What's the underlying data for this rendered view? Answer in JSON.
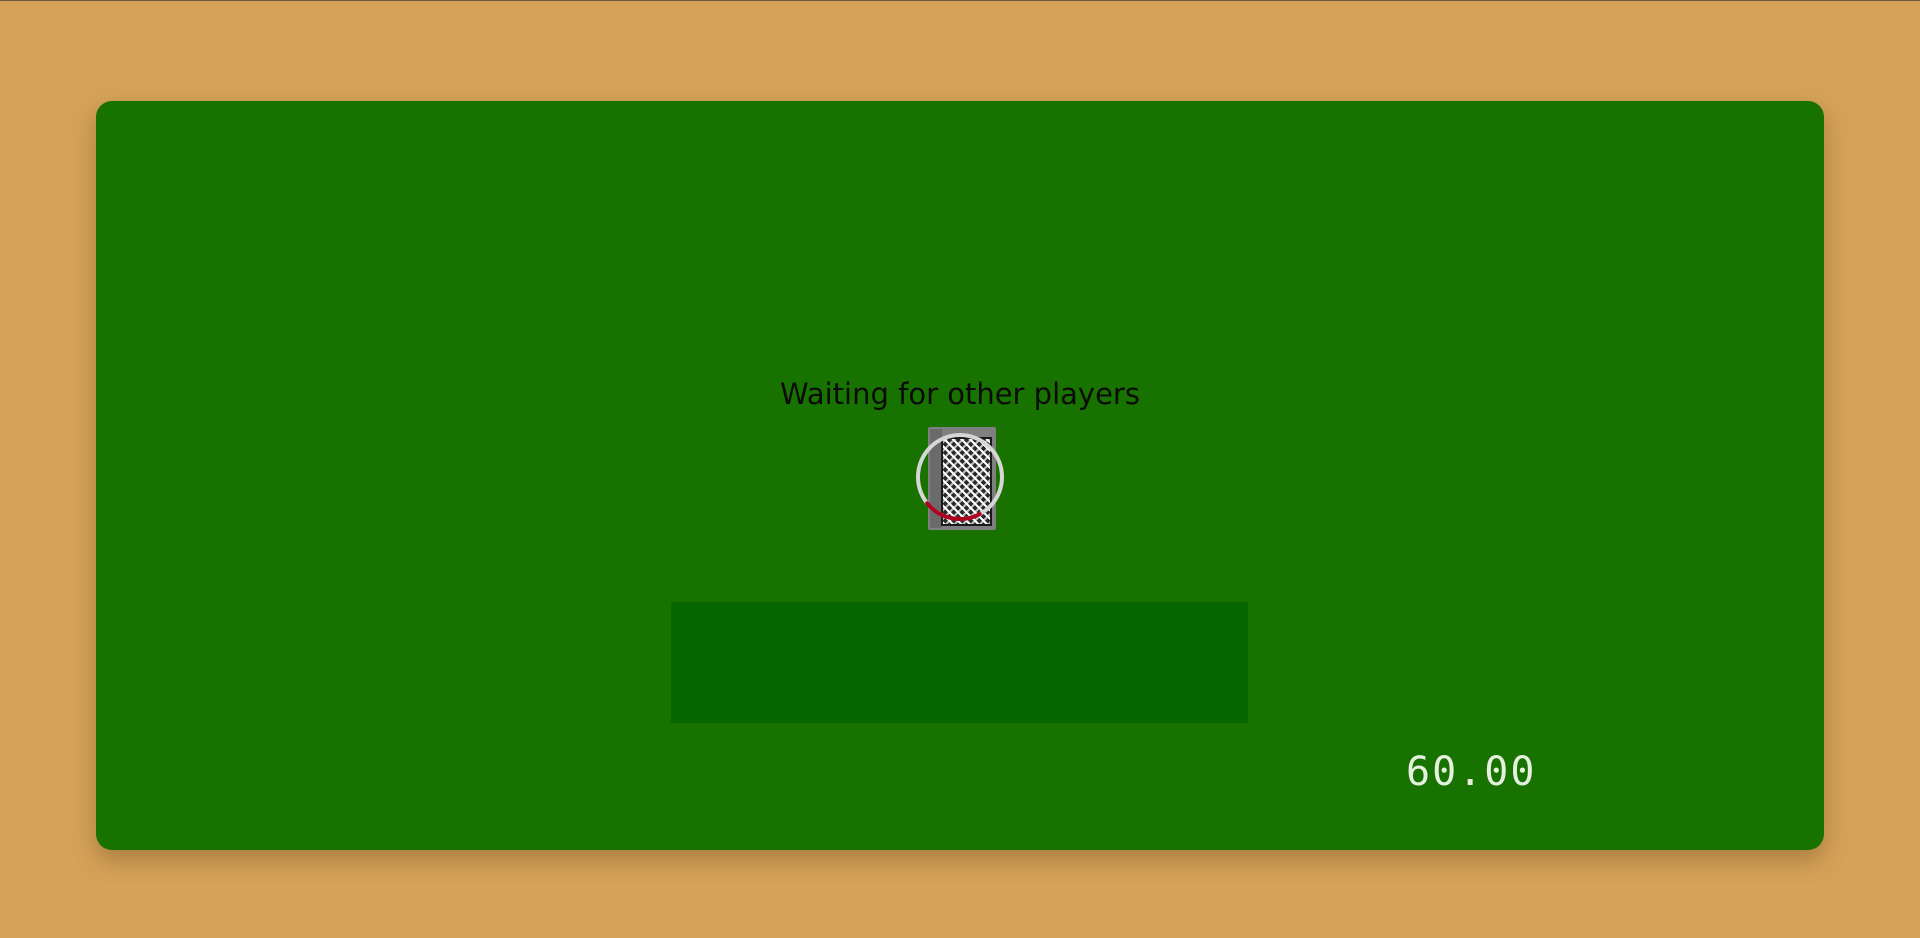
{
  "table": {
    "status_text": "Waiting for other players",
    "timer": "60.00"
  },
  "colors": {
    "background": "#d5a258",
    "felt": "#187200",
    "hand_zone": "#066600",
    "spinner_ring": "#d6d6d6",
    "spinner_progress": "#b00020"
  },
  "spinner": {
    "progress": 0.22
  }
}
